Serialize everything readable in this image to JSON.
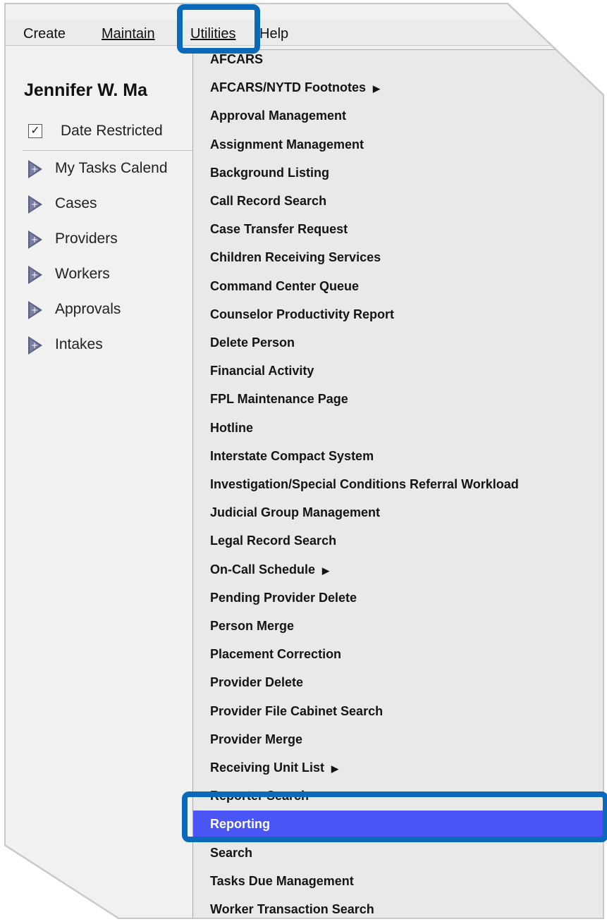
{
  "menubar": {
    "items": [
      {
        "label": "Create"
      },
      {
        "label": "Maintain"
      },
      {
        "label": "Utilities"
      },
      {
        "label": "Help"
      }
    ]
  },
  "page": {
    "title": "Jennifer W. Ma",
    "date_restricted_label": "Date Restricted",
    "date_restricted_checked": true
  },
  "tree": {
    "items": [
      {
        "label": "My Tasks Calend"
      },
      {
        "label": "Cases"
      },
      {
        "label": "Providers"
      },
      {
        "label": "Workers"
      },
      {
        "label": "Approvals"
      },
      {
        "label": "Intakes"
      }
    ]
  },
  "utilities_menu": {
    "items": [
      {
        "label": "AFCARS"
      },
      {
        "label": "AFCARS/NYTD Footnotes",
        "has_submenu": true
      },
      {
        "label": "Approval Management"
      },
      {
        "label": "Assignment Management"
      },
      {
        "label": "Background Listing"
      },
      {
        "label": "Call Record Search"
      },
      {
        "label": "Case Transfer Request"
      },
      {
        "label": "Children Receiving Services"
      },
      {
        "label": "Command Center Queue"
      },
      {
        "label": "Counselor Productivity Report"
      },
      {
        "label": "Delete Person"
      },
      {
        "label": "Financial Activity"
      },
      {
        "label": "FPL Maintenance Page"
      },
      {
        "label": "Hotline"
      },
      {
        "label": "Interstate Compact System"
      },
      {
        "label": "Investigation/Special Conditions Referral Workload"
      },
      {
        "label": "Judicial Group Management"
      },
      {
        "label": "Legal Record Search"
      },
      {
        "label": "On-Call Schedule",
        "has_submenu": true
      },
      {
        "label": "Pending Provider Delete"
      },
      {
        "label": "Person Merge"
      },
      {
        "label": "Placement Correction"
      },
      {
        "label": "Provider Delete"
      },
      {
        "label": "Provider File Cabinet Search"
      },
      {
        "label": "Provider Merge"
      },
      {
        "label": "Receiving Unit List",
        "has_submenu": true
      },
      {
        "label": "Reporter Search"
      },
      {
        "label": "Reporting",
        "selected": true
      },
      {
        "label": "Search"
      },
      {
        "label": "Tasks Due Management"
      },
      {
        "label": "Worker Transaction Search"
      }
    ],
    "submenu_glyph": "▶"
  },
  "colors": {
    "highlight_border": "#0a69b8",
    "selected_bg": "#4a55f6"
  }
}
